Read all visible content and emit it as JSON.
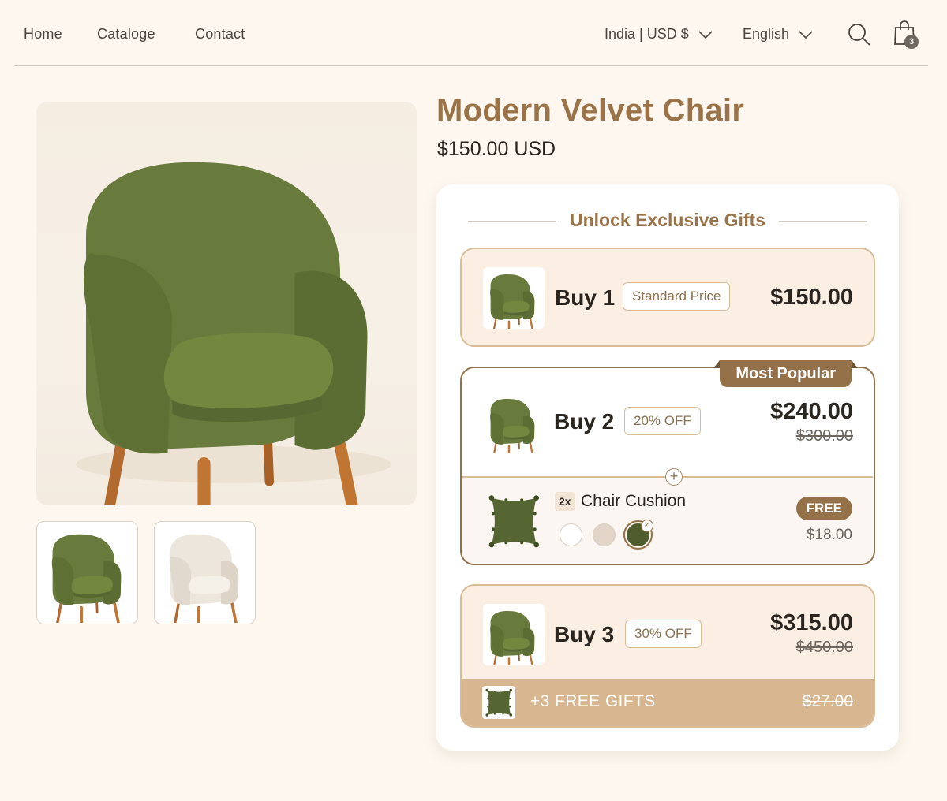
{
  "nav": {
    "links": [
      "Home",
      "Cataloge",
      "Contact"
    ],
    "currency": "India | USD $",
    "language": "English",
    "cart_count": "3",
    "icons": [
      "chevron-down-icon",
      "search-icon",
      "shopping-bag-icon"
    ]
  },
  "gallery": {
    "main_alt": "green armchair",
    "thumbnails": [
      "green-armchair",
      "cream-armchair"
    ]
  },
  "product": {
    "title": "Modern Velvet Chair",
    "price": "$150.00 USD"
  },
  "offers": {
    "heading": "Unlock Exclusive Gifts",
    "tiers": [
      {
        "qty": "Buy 1",
        "tag": "Standard Price",
        "price": "$150.00"
      },
      {
        "qty": "Buy 2",
        "tag": "20% OFF",
        "price": "$240.00",
        "old_price": "$300.00",
        "badge": "Most Popular",
        "addon": {
          "qty": "2x",
          "name": "Chair Cushion",
          "price_label": "FREE",
          "old_price": "$18.00",
          "swatches": [
            "#ffffff",
            "#e2d4c6",
            "#4f5d2e"
          ],
          "selected_swatch": 2
        }
      },
      {
        "qty": "Buy 3",
        "tag": "30% OFF",
        "price": "$315.00",
        "old_price": "$450.00",
        "gift_label": "+3 FREE GIFTS",
        "gift_old_price": "$27.00"
      }
    ]
  },
  "colors": {
    "accent_brown": "#957149",
    "title_brown": "#9a7448",
    "background": "#fdf7f0",
    "chair_green": "#6b7b3e"
  }
}
